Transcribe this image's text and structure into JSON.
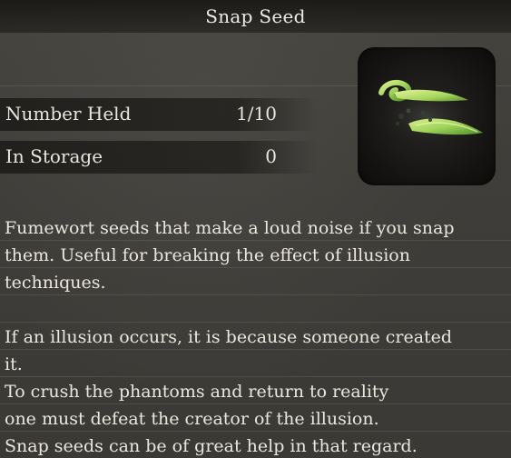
{
  "item": {
    "name": "Snap Seed",
    "icon": "snap-seed-icon"
  },
  "stats": {
    "number_held": {
      "label": "Number Held",
      "value": "1/10"
    },
    "in_storage": {
      "label": "In Storage",
      "value": "0"
    }
  },
  "description": {
    "paragraph1_lines": [
      "Fumewort seeds that make a loud noise if you snap",
      "them.  Useful for breaking the effect of illusion",
      "techniques."
    ],
    "paragraph2_lines": [
      "If an illusion occurs, it is because someone created",
      "it.",
      "To crush the phantoms and return to reality",
      "one must defeat the creator of the illusion.",
      "Snap seeds can be of great help in that regard."
    ]
  },
  "colors": {
    "background": "#3f3d39",
    "text": "#e7e3d8",
    "seed_green": "#9fd35a"
  }
}
